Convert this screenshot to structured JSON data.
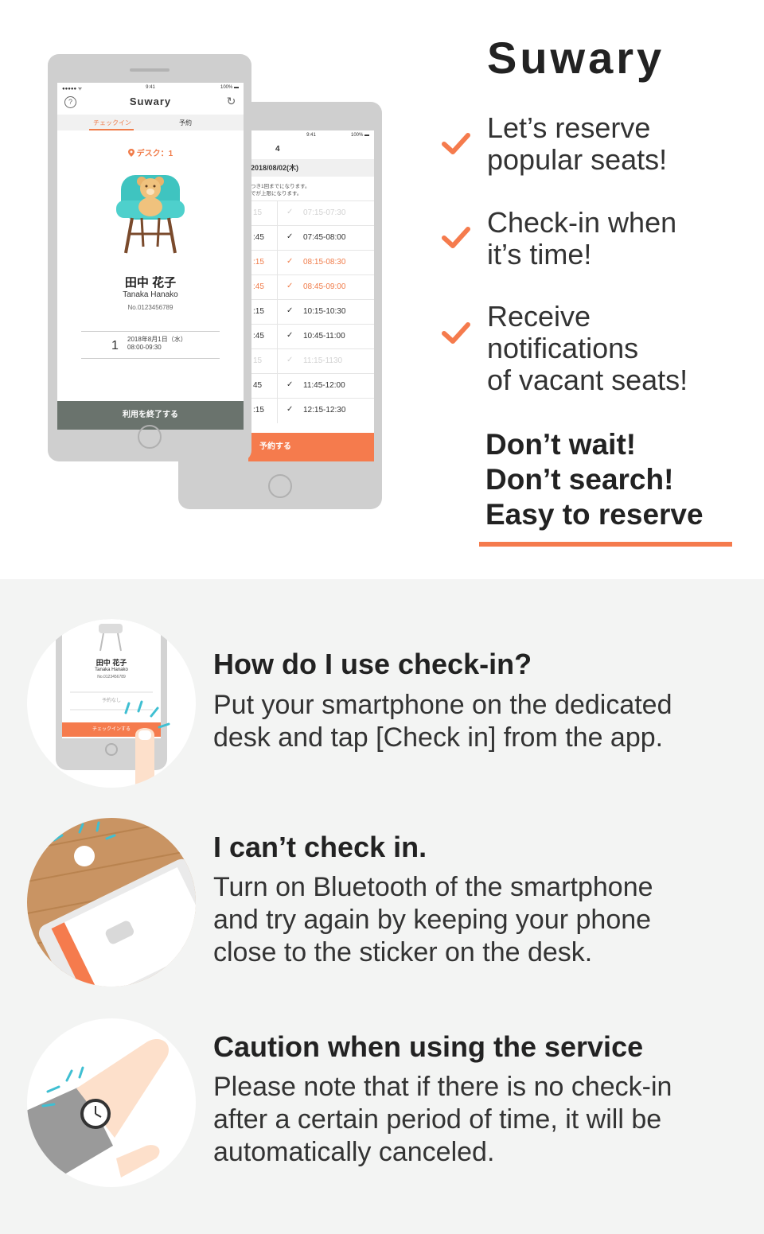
{
  "brand": {
    "title": "Suwary"
  },
  "colors": {
    "accent": "#f57b4d",
    "teal": "#4cc9c6",
    "dark": "#222222"
  },
  "features": [
    {
      "lines": [
        "Let’s reserve",
        "popular seats!"
      ],
      "icon": "check-icon"
    },
    {
      "lines": [
        "Check-in when",
        "it’s time!"
      ],
      "icon": "check-icon"
    },
    {
      "lines": [
        "Receive",
        "notifications",
        "of vacant seats!"
      ],
      "icon": "check-icon"
    }
  ],
  "tagline": {
    "line1": "Don’t wait!",
    "line2": "Don’t search!",
    "line3": "Easy to reserve"
  },
  "front_phone": {
    "status_left": "●●●●● ᯤ",
    "status_time": "9:41",
    "status_right": "100% ▬",
    "app_title": "Suwary",
    "help_icon": "?",
    "history_icon": "↻",
    "tab_checkin": "チェックイン",
    "tab_reserve": "予約",
    "desk_label": "デスク：1",
    "user_name_jp": "田中 花子",
    "user_name_en": "Tanaka Hanako",
    "user_no": "No.0123456789",
    "reservation_num": "1",
    "reservation_date": "2018年8月1日（水）",
    "reservation_time": "08:00-09:30",
    "end_button": "利用を終了する"
  },
  "back_phone": {
    "status_time": "9:41",
    "status_right": "100% ▬",
    "title": "4",
    "date": "2018/08/02(木)",
    "note_line1": "つき1回までになります。",
    "note_line2": "でが上限になります。",
    "slots": [
      {
        "left": "15",
        "time": "07:15-07:30",
        "state": "dim"
      },
      {
        "left": ":45",
        "time": "07:45-08:00",
        "state": "normal"
      },
      {
        "left": ":15",
        "time": "08:15-08:30",
        "state": "orange"
      },
      {
        "left": ":45",
        "time": "08:45-09:00",
        "state": "orange"
      },
      {
        "left": ":15",
        "time": "10:15-10:30",
        "state": "normal"
      },
      {
        "left": ":45",
        "time": "10:45-11:00",
        "state": "normal"
      },
      {
        "left": "15",
        "time": "11:15-1130",
        "state": "dim"
      },
      {
        "left": "45",
        "time": "11:45-12:00",
        "state": "normal"
      },
      {
        "left": ":15",
        "time": "12:15-12:30",
        "state": "normal"
      }
    ],
    "reserve_button": "予約する"
  },
  "faq": [
    {
      "title": "How do I use check-in?",
      "body": [
        "Put your smartphone on the dedicated",
        "desk and tap [Check in] from the app."
      ],
      "illustration": {
        "name_jp": "田中 花子",
        "name_en": "Tanaka Hanako",
        "no": "No.0123456789",
        "no_reservation": "予約なし",
        "button": "チェックインする"
      }
    },
    {
      "title": "I can’t check in.",
      "body": [
        "Turn on Bluetooth of the smartphone",
        "and try again by keeping your phone",
        "close to the sticker on the desk."
      ]
    },
    {
      "title": "Caution when using the service",
      "body": [
        "Please note that if there is no check-in",
        "after a certain period of time, it will be",
        "automatically canceled."
      ]
    }
  ]
}
